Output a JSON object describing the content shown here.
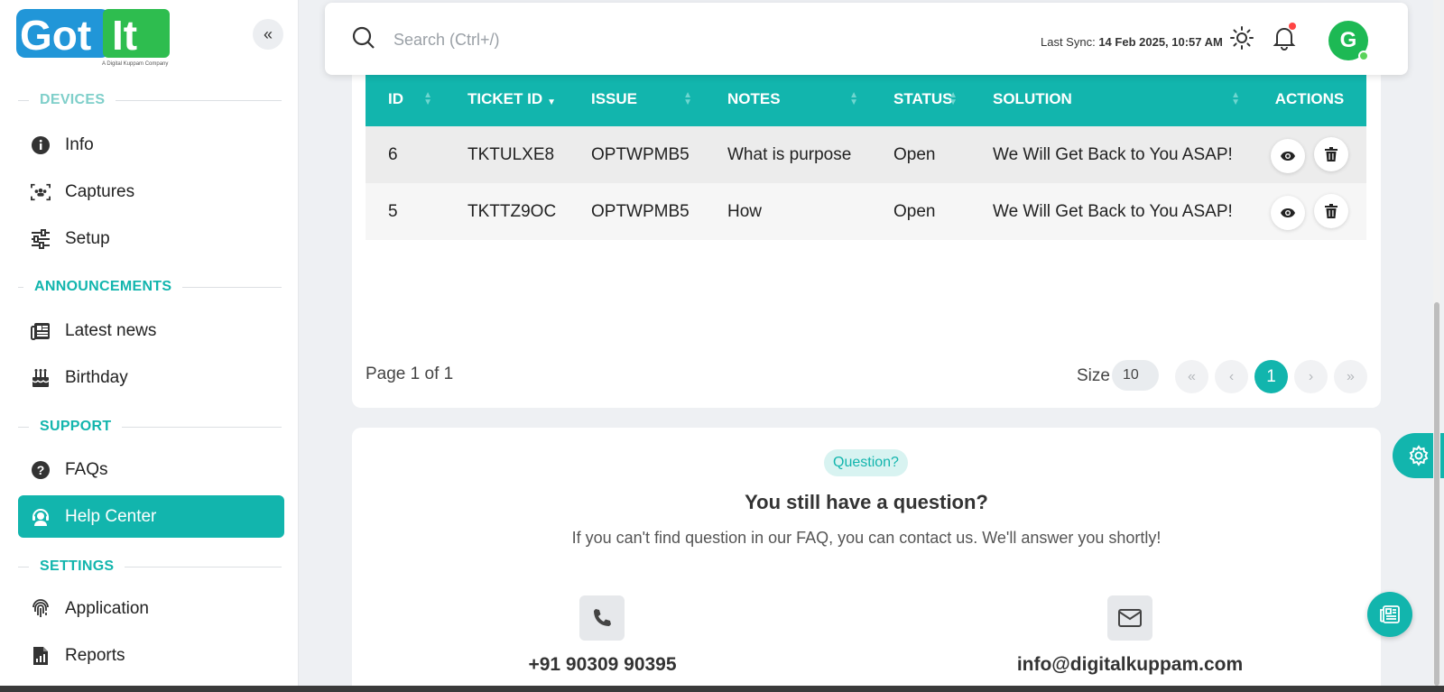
{
  "brand": {
    "logo_text": "GotIt",
    "logo_tagline": "A Digital Kuppam Company",
    "colors": {
      "accent": "#12b5ad",
      "logo_blue": "#2196d8",
      "logo_green": "#2ebd4f"
    }
  },
  "sidebar": {
    "collapse_icon": "chevrons-left-icon",
    "sections": [
      {
        "title": "DEVICES",
        "items": [
          {
            "label": "Info",
            "icon": "info-circle-icon"
          },
          {
            "label": "Captures",
            "icon": "captures-icon"
          },
          {
            "label": "Setup",
            "icon": "sliders-icon"
          }
        ]
      },
      {
        "title": "ANNOUNCEMENTS",
        "items": [
          {
            "label": "Latest news",
            "icon": "newspaper-icon"
          },
          {
            "label": "Birthday",
            "icon": "cake-icon"
          }
        ]
      },
      {
        "title": "SUPPORT",
        "items": [
          {
            "label": "FAQs",
            "icon": "question-circle-icon"
          },
          {
            "label": "Help Center",
            "icon": "headset-icon",
            "active": true
          }
        ]
      },
      {
        "title": "SETTINGS",
        "items": [
          {
            "label": "Application",
            "icon": "fingerprint-icon"
          },
          {
            "label": "Reports",
            "icon": "report-file-icon"
          }
        ]
      }
    ]
  },
  "topbar": {
    "search_placeholder": "Search (Ctrl+/)",
    "sync_label": "Last Sync:",
    "sync_value": "14 Feb 2025, 10:57 AM"
  },
  "tickets": {
    "columns": [
      "ID",
      "TICKET ID",
      "ISSUE",
      "NOTES",
      "STATUS",
      "SOLUTION",
      "ACTIONS"
    ],
    "rows": [
      {
        "id": "6",
        "ticket_id": "TKTULXE8",
        "issue": "OPTWPMB5",
        "notes": "What is purpose",
        "status": "Open",
        "solution": "We Will Get Back to You ASAP!"
      },
      {
        "id": "5",
        "ticket_id": "TKTTZ9OC",
        "issue": "OPTWPMB5",
        "notes": "How",
        "status": "Open",
        "solution": "We Will Get Back to You ASAP!"
      }
    ],
    "pagination": {
      "page_info": "Page 1 of 1",
      "size_label": "Size",
      "size_value": "10",
      "first": "«",
      "prev": "‹",
      "current": "1",
      "next": "›",
      "last": "»"
    }
  },
  "question": {
    "badge": "Question?",
    "title": "You still have a question?",
    "subtitle": "If you can't find question in our FAQ, you can contact us. We'll answer you shortly!",
    "phone": "+91 90309 90395",
    "email": "info@digitalkuppam.com"
  }
}
